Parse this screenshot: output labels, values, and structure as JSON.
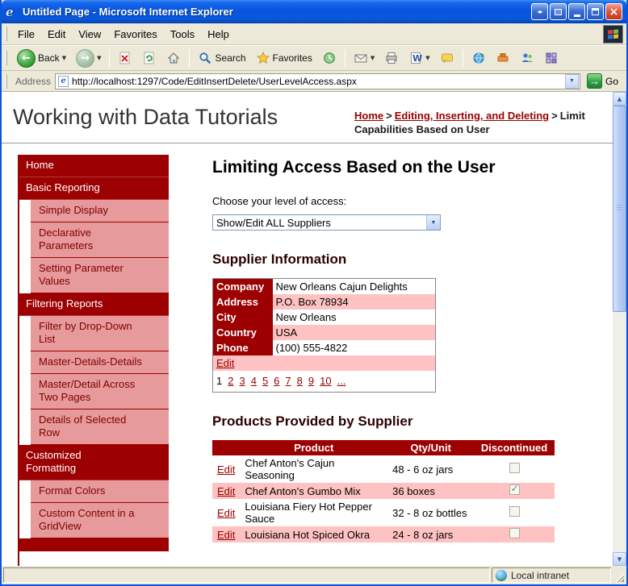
{
  "colors": {
    "maroon": "#990000",
    "sidebar_pink": "#E79A9B",
    "row_pink": "#FFC2C2",
    "titlebar_blue": "#0855DD"
  },
  "window": {
    "title": "Untitled Page - Microsoft Internet Explorer"
  },
  "menu": {
    "items": [
      "File",
      "Edit",
      "View",
      "Favorites",
      "Tools",
      "Help"
    ]
  },
  "toolbar": {
    "back": "Back",
    "search": "Search",
    "favorites": "Favorites"
  },
  "address": {
    "label": "Address",
    "url": "http://localhost:1297/Code/EditInsertDelete/UserLevelAccess.aspx",
    "go": "Go"
  },
  "page": {
    "site_title": "Working with Data Tutorials",
    "breadcrumb": {
      "links": [
        "Home",
        "Editing, Inserting, and Deleting"
      ],
      "separator": ">",
      "current": "Limit Capabilities Based on User"
    },
    "sidebar": [
      {
        "label": "Home",
        "level": 1
      },
      {
        "label": "Basic Reporting",
        "level": 1
      },
      {
        "label": "Simple Display",
        "level": 2
      },
      {
        "label": "Declarative Parameters",
        "level": 2
      },
      {
        "label": "Setting Parameter Values",
        "level": 2
      },
      {
        "label": "Filtering Reports",
        "level": 1
      },
      {
        "label": "Filter by Drop-Down List",
        "level": 2
      },
      {
        "label": "Master-Details-Details",
        "level": 2
      },
      {
        "label": "Master/Detail Across Two Pages",
        "level": 2
      },
      {
        "label": "Details of Selected Row",
        "level": 2
      },
      {
        "label": "Customized Formatting",
        "level": 1
      },
      {
        "label": "Format Colors",
        "level": 2
      },
      {
        "label": "Custom Content in a GridView",
        "level": 2
      }
    ],
    "main": {
      "title": "Limiting Access Based on the User",
      "access_label": "Choose your level of access:",
      "access_value": "Show/Edit ALL Suppliers",
      "supplier": {
        "heading": "Supplier Information",
        "fields": [
          {
            "label": "Company",
            "value": "New Orleans Cajun Delights"
          },
          {
            "label": "Address",
            "value": "P.O. Box 78934"
          },
          {
            "label": "City",
            "value": "New Orleans"
          },
          {
            "label": "Country",
            "value": "USA"
          },
          {
            "label": "Phone",
            "value": "(100) 555-4822"
          }
        ],
        "edit_label": "Edit",
        "pager": {
          "current": "1",
          "pages": [
            "2",
            "3",
            "4",
            "5",
            "6",
            "7",
            "8",
            "9",
            "10",
            "..."
          ]
        }
      },
      "products": {
        "heading": "Products Provided by Supplier",
        "columns": [
          "Product",
          "Qty/Unit",
          "Discontinued"
        ],
        "edit_label": "Edit",
        "rows": [
          {
            "product": "Chef Anton's Cajun Seasoning",
            "qty": "48 - 6 oz jars",
            "discontinued": false
          },
          {
            "product": "Chef Anton's Gumbo Mix",
            "qty": "36 boxes",
            "discontinued": true
          },
          {
            "product": "Louisiana Fiery Hot Pepper Sauce",
            "qty": "32 - 8 oz bottles",
            "discontinued": false
          },
          {
            "product": "Louisiana Hot Spiced Okra",
            "qty": "24 - 8 oz jars",
            "discontinued": false
          }
        ]
      }
    }
  },
  "status": {
    "zone": "Local intranet"
  }
}
